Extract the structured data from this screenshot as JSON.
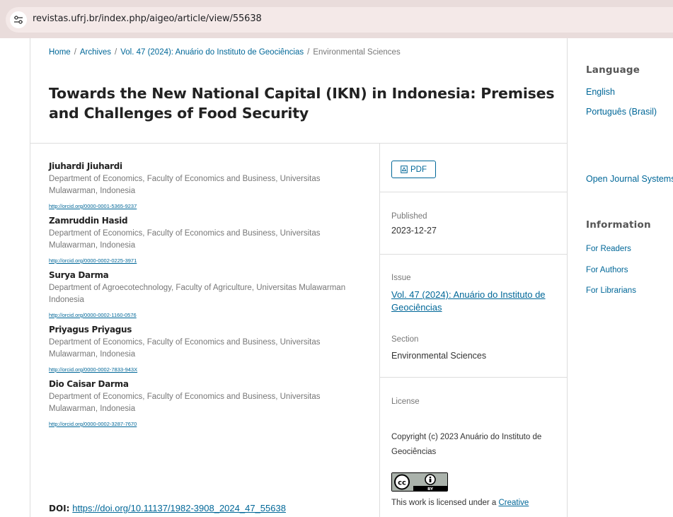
{
  "browser": {
    "url": "revistas.ufrj.br/index.php/aigeo/article/view/55638",
    "site_info_icon": "tune-icon"
  },
  "breadcrumb": {
    "home": "Home",
    "archives": "Archives",
    "issue": "Vol. 47 (2024): Anuário do Instituto de Geociências",
    "current": "Environmental Sciences",
    "separator": "/"
  },
  "article": {
    "title": "Towards the New National Capital (IKN) in Indonesia: Premises and Challenges of Food Security",
    "authors": [
      {
        "name": "Jiuhardi Jiuhardi",
        "affiliation": "Department of Economics, Faculty of Economics and Business, Universitas Mulawarman, Indonesia",
        "orcid": "http://orcid.org/0000-0001-5365-9237"
      },
      {
        "name": "Zamruddin Hasid",
        "affiliation": "Department of Economics, Faculty of Economics and Business, Universitas Mulawarman, Indonesia",
        "orcid": "http://orcid.org/0000-0002-0225-3971"
      },
      {
        "name": "Surya Darma",
        "affiliation": "Department of Agroecotechnology, Faculty of Agriculture, Universitas Mulawarman Indonesia",
        "orcid": "http://orcid.org/0000-0002-1160-0576"
      },
      {
        "name": "Priyagus Priyagus",
        "affiliation": "Department of Economics, Faculty of Economics and Business, Universitas Mulawarman, Indonesia",
        "orcid": "http://orcid.org/0000-0002-7833-943X"
      },
      {
        "name": "Dio Caisar Darma",
        "affiliation": "Department of Economics, Faculty of Economics and Business, Universitas Mulawarman, Indonesia",
        "orcid": "http://orcid.org/0000-0002-3287-7670"
      }
    ],
    "doi_label": "DOI:",
    "doi_link": "https://doi.org/10.11137/1982-3908_2024_47_55638"
  },
  "details": {
    "pdf_label": "PDF",
    "published_label": "Published",
    "published_value": "2023-12-27",
    "issue_label": "Issue",
    "issue_value": "Vol. 47 (2024): Anuário do Instituto de Geociências",
    "section_label": "Section",
    "section_value": "Environmental Sciences",
    "license_label": "License",
    "copyright": "Copyright (c) 2023 Anuário do Instituto de Geociências",
    "license_prefix": "This work is licensed under a ",
    "license_link": "Creative",
    "cc_badge_text": "BY"
  },
  "sidebar": {
    "language_heading": "Language",
    "languages": [
      "English",
      "Português (Brasil)"
    ],
    "ojs_link": "Open Journal Systems",
    "information_heading": "Information",
    "information_links": [
      "For Readers",
      "For Authors",
      "For Librarians"
    ]
  },
  "colors": {
    "link": "#006798",
    "addressbar": "#e9dcdb",
    "border": "#dddddd"
  }
}
